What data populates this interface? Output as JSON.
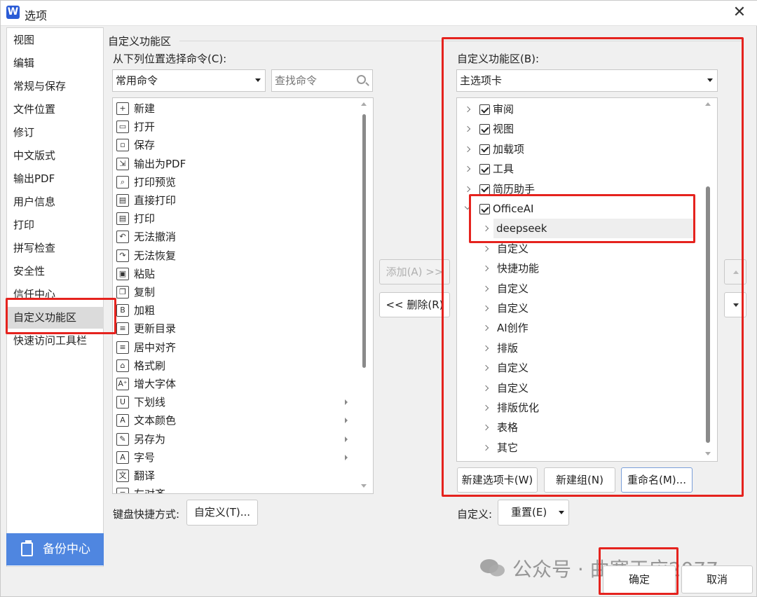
{
  "window": {
    "title": "选项",
    "app_icon": "W",
    "close_glyph": "✕"
  },
  "nav": {
    "items": [
      {
        "label": "视图"
      },
      {
        "label": "编辑"
      },
      {
        "label": "常规与保存"
      },
      {
        "label": "文件位置"
      },
      {
        "label": "修订"
      },
      {
        "label": "中文版式"
      },
      {
        "label": "输出PDF"
      },
      {
        "label": "用户信息"
      },
      {
        "label": "打印"
      },
      {
        "label": "拼写检查"
      },
      {
        "label": "安全性"
      },
      {
        "label": "信任中心"
      },
      {
        "label": "自定义功能区",
        "selected": true
      },
      {
        "label": "快速访问工具栏"
      }
    ],
    "backup_label": "备份中心"
  },
  "group_title": "自定义功能区",
  "left": {
    "choose_label": "从下列位置选择命令(C):",
    "source_value": "常用命令",
    "search_placeholder": "查找命令",
    "commands": [
      {
        "label": "新建",
        "icon": "new-file-icon",
        "glyph": "+"
      },
      {
        "label": "打开",
        "icon": "open-folder-icon",
        "glyph": "▭"
      },
      {
        "label": "保存",
        "icon": "save-icon",
        "glyph": "▫"
      },
      {
        "label": "输出为PDF",
        "icon": "export-pdf-icon",
        "glyph": "⇲"
      },
      {
        "label": "打印预览",
        "icon": "print-preview-icon",
        "glyph": "⌕"
      },
      {
        "label": "直接打印",
        "icon": "direct-print-icon",
        "glyph": "▤"
      },
      {
        "label": "打印",
        "icon": "print-icon",
        "glyph": "▤"
      },
      {
        "label": "无法撤消",
        "icon": "undo-icon",
        "glyph": "↶"
      },
      {
        "label": "无法恢复",
        "icon": "redo-icon",
        "glyph": "↷"
      },
      {
        "label": "粘贴",
        "icon": "paste-icon",
        "glyph": "▣"
      },
      {
        "label": "复制",
        "icon": "copy-icon",
        "glyph": "❐"
      },
      {
        "label": "加粗",
        "icon": "bold-icon",
        "glyph": "B"
      },
      {
        "label": "更新目录",
        "icon": "update-toc-icon",
        "glyph": "≡"
      },
      {
        "label": "居中对齐",
        "icon": "align-center-icon",
        "glyph": "≡"
      },
      {
        "label": "格式刷",
        "icon": "format-painter-icon",
        "glyph": "⌂"
      },
      {
        "label": "增大字体",
        "icon": "grow-font-icon",
        "glyph": "A⁺"
      },
      {
        "label": "下划线",
        "icon": "underline-icon",
        "glyph": "U",
        "submenu": true
      },
      {
        "label": "文本颜色",
        "icon": "text-color-icon",
        "glyph": "A",
        "submenu": true
      },
      {
        "label": "另存为",
        "icon": "save-as-icon",
        "glyph": "✎",
        "submenu": true
      },
      {
        "label": "字号",
        "icon": "font-size-icon",
        "glyph": "A",
        "submenu": true
      },
      {
        "label": "翻译",
        "icon": "translate-icon",
        "glyph": "文"
      },
      {
        "label": "左对齐",
        "icon": "align-left-icon",
        "glyph": "≡"
      }
    ],
    "keyboard_label": "键盘快捷方式:",
    "keyboard_button": "自定义(T)..."
  },
  "middle": {
    "add_button": "添加(A) >>",
    "remove_button": "<< 删除(R)"
  },
  "right": {
    "ribbon_label": "自定义功能区(B):",
    "ribbon_value": "主选项卡",
    "tree": [
      {
        "label": "审阅",
        "level": 0,
        "checked": true
      },
      {
        "label": "视图",
        "level": 0,
        "checked": true
      },
      {
        "label": "加载项",
        "level": 0,
        "checked": true
      },
      {
        "label": "工具",
        "level": 0,
        "checked": true
      },
      {
        "label": "简历助手",
        "level": 0,
        "checked": true
      },
      {
        "label": "OfficeAI",
        "level": 0,
        "checked": true,
        "expanded": true
      },
      {
        "label": "deepseek",
        "level": 1,
        "highlighted": true
      },
      {
        "label": "自定义",
        "level": 1
      },
      {
        "label": "快捷功能",
        "level": 1
      },
      {
        "label": "自定义",
        "level": 1
      },
      {
        "label": "自定义",
        "level": 1
      },
      {
        "label": "AI创作",
        "level": 1
      },
      {
        "label": "排版",
        "level": 1
      },
      {
        "label": "自定义",
        "level": 1
      },
      {
        "label": "自定义",
        "level": 1
      },
      {
        "label": "排版优化",
        "level": 1
      },
      {
        "label": "表格",
        "level": 1
      },
      {
        "label": "其它",
        "level": 1
      }
    ],
    "new_tab_button": "新建选项卡(W)",
    "new_group_button": "新建组(N)",
    "rename_button": "重命名(M)...",
    "customize_label": "自定义:",
    "reset_button": "重置(E)"
  },
  "footer": {
    "ok_button": "确定",
    "cancel_button": "取消"
  },
  "watermark": "公众号 · 曲寒天应2077",
  "colors": {
    "highlight_red": "#e5231e",
    "backup_blue": "#4f86e0",
    "app_icon_blue": "#2b5cd6"
  }
}
